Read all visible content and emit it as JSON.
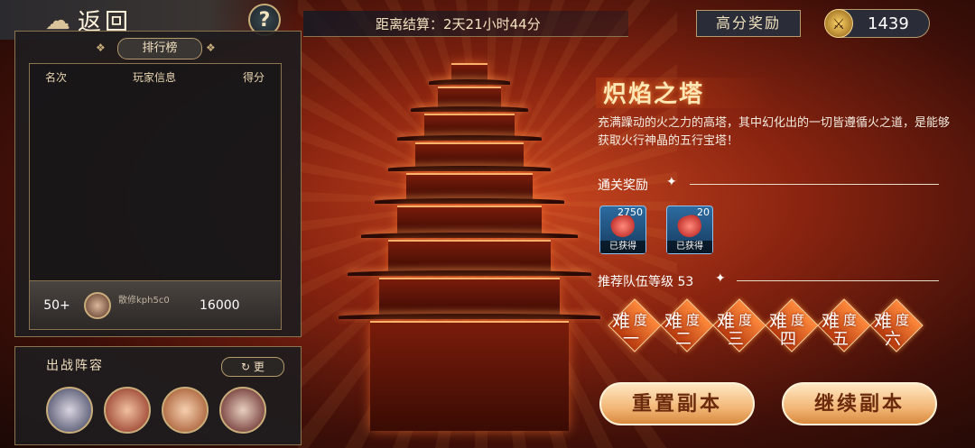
{
  "nav": {
    "back_label": "返回",
    "help_label": "?"
  },
  "leaderboard": {
    "title": "排行榜",
    "columns": [
      "名次",
      "玩家信息",
      "得分"
    ],
    "my_entry": {
      "rank": "50+",
      "name": "散修kph5c0",
      "score": "16000"
    }
  },
  "lineup": {
    "title": "出战阵容",
    "more_label": "更"
  },
  "header": {
    "countdown": "距离结算：2天21小时44分",
    "high_reward_label": "高分奖励",
    "currency_value": "1439"
  },
  "tower": {
    "name": "炽焰之塔",
    "description": "充满躁动的火之力的高塔，其中幻化出的一切皆遵循火之道，是能够获取火行神晶的五行宝塔！"
  },
  "rewards": {
    "title": "通关奖励",
    "items": [
      {
        "count": "2750",
        "status": "已获得"
      },
      {
        "count": "20",
        "status": "已获得"
      }
    ]
  },
  "recommend": {
    "label": "推荐队伍等级 53"
  },
  "difficulties": [
    {
      "a": "难",
      "b": "度",
      "c": "一"
    },
    {
      "a": "难",
      "b": "度",
      "c": "二"
    },
    {
      "a": "难",
      "b": "度",
      "c": "三"
    },
    {
      "a": "难",
      "b": "度",
      "c": "四"
    },
    {
      "a": "难",
      "b": "度",
      "c": "五"
    },
    {
      "a": "难",
      "b": "度",
      "c": "六"
    }
  ],
  "actions": {
    "reset_label": "重置副本",
    "continue_label": "继续副本"
  },
  "colors": {
    "accent_gold": "#c9ad7a",
    "button_text": "#6b2a0c",
    "fire": "#c8461f"
  }
}
